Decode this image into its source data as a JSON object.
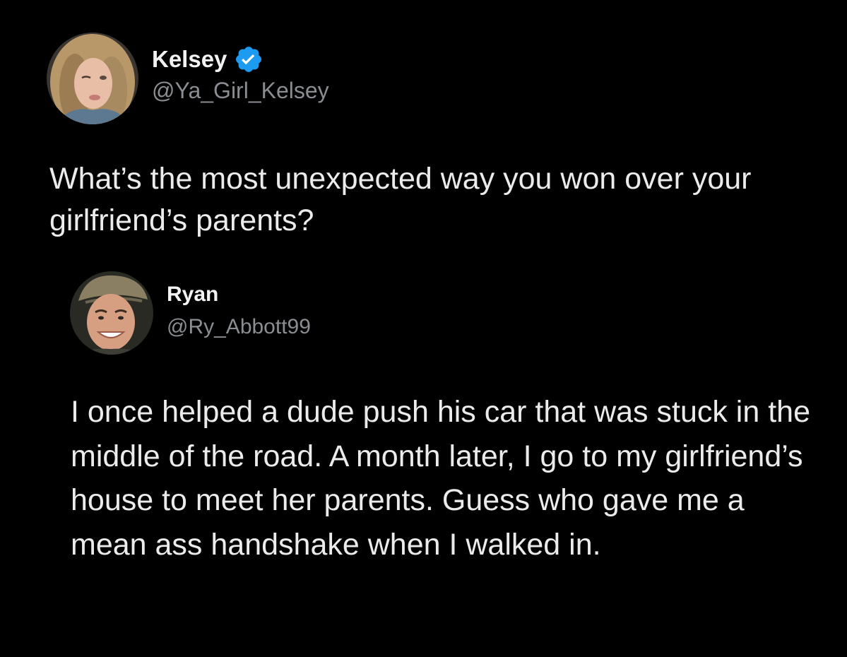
{
  "tweets": [
    {
      "display_name": "Kelsey",
      "verified": true,
      "verified_icon": "verified-badge-icon",
      "handle": "@Ya_Girl_Kelsey",
      "text": "What’s the most unexpected way you won over your girlfriend’s parents?"
    },
    {
      "display_name": "Ryan",
      "verified": false,
      "handle": "@Ry_Abbott99",
      "text": "I once helped a dude push his car that was stuck in the middle of the road. A month later, I go to my girlfriend’s house to meet her parents. Guess who gave me a mean ass handshake when I walked in."
    }
  ],
  "colors": {
    "background": "#000000",
    "primary_text": "#ebebeb",
    "secondary_text": "#8a8d91",
    "verified_blue": "#1d9bf0"
  }
}
